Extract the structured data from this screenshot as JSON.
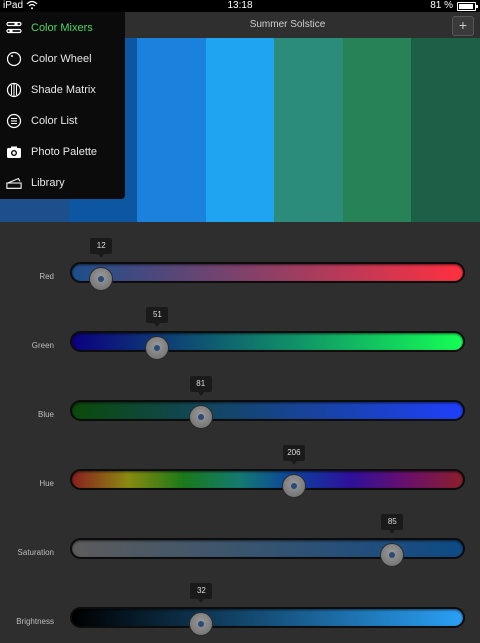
{
  "status_bar": {
    "carrier": "iPad",
    "time": "13:18",
    "battery": "81 %"
  },
  "navbar": {
    "title": "Summer Solstice",
    "add_label": "+"
  },
  "palette": [
    "#1d4f8c",
    "#0d56a2",
    "#1a82dc",
    "#1ea4f0",
    "#2b8c7c",
    "#278258",
    "#1b6047"
  ],
  "menu": {
    "items": [
      {
        "label": "Color Mixers",
        "icon": "sliders-icon"
      },
      {
        "label": "Color Wheel",
        "icon": "wheel-icon"
      },
      {
        "label": "Shade Matrix",
        "icon": "matrix-icon"
      },
      {
        "label": "Color List",
        "icon": "list-icon"
      },
      {
        "label": "Photo Palette",
        "icon": "camera-icon"
      },
      {
        "label": "Library",
        "icon": "library-icon"
      }
    ],
    "active_color": "#4cd964"
  },
  "sliders": [
    {
      "label": "Red",
      "value": "12",
      "fraction": 0.047
    },
    {
      "label": "Green",
      "value": "51",
      "fraction": 0.2
    },
    {
      "label": "Blue",
      "value": "81",
      "fraction": 0.318
    },
    {
      "label": "Hue",
      "value": "206",
      "fraction": 0.572
    },
    {
      "label": "Saturation",
      "value": "85",
      "fraction": 0.84
    },
    {
      "label": "Brightness",
      "value": "32",
      "fraction": 0.32
    }
  ]
}
